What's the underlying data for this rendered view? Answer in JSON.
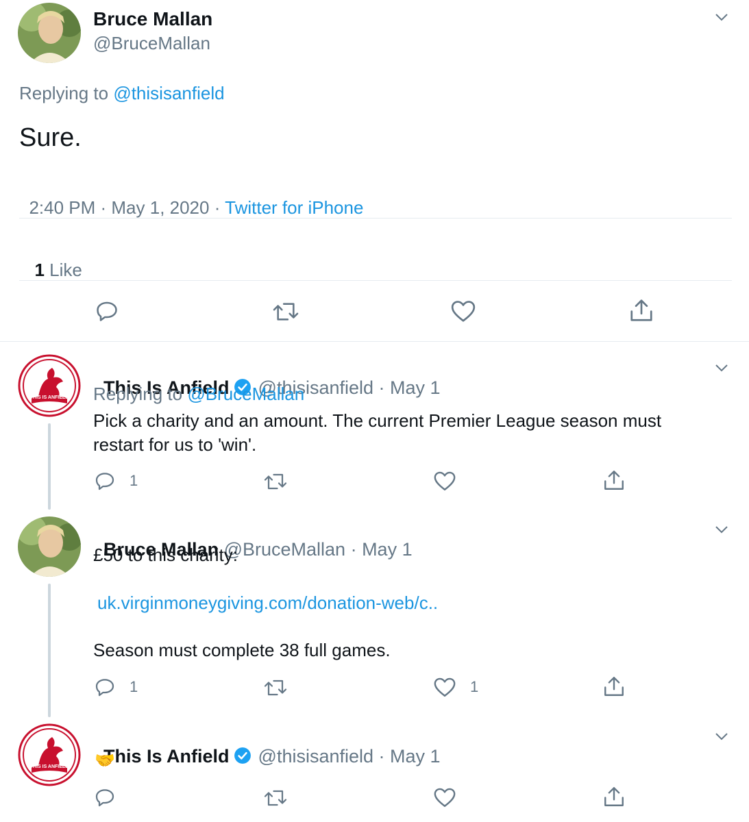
{
  "main_tweet": {
    "name": "Bruce Mallan",
    "handle": "@BruceMallan",
    "replying_prefix": "Replying to",
    "replying_handle": "@thisisanfield",
    "text": "Sure.",
    "timestamp": "2:40 PM · May 1, 2020 · ",
    "source": "Twitter for iPhone",
    "like_count": "1",
    "like_label": " Like"
  },
  "replies": [
    {
      "name": "This Is Anfield",
      "handle": "@thisisanfield · May 1",
      "replying_prefix": "Replying to",
      "replying_handle": "@BruceMallan",
      "text_line1": "Pick a charity and an amount. The current Premier League season must",
      "text_line2": "restart for us to 'win'.",
      "reply_count": "1",
      "like_count": ""
    },
    {
      "name": "Bruce Mallan",
      "handle": "@BruceMallan · May 1",
      "text_line1": "£50 to this charity:",
      "link": "uk.virginmoneygiving.com/donation-web/c..",
      "text_line3": "Season must complete 38 full games.",
      "reply_count": "1",
      "like_count": "1"
    },
    {
      "name": "This Is Anfield",
      "handle": "@thisisanfield · May 1",
      "text_emoji": "🤝",
      "reply_count": "",
      "like_count": ""
    }
  ],
  "logo": {
    "text": "THIS IS ANFIELD"
  },
  "colors": {
    "link": "#1b95e0",
    "muted": "#657786",
    "lfc_red": "#c8102e",
    "verified": "#1da1f2"
  }
}
